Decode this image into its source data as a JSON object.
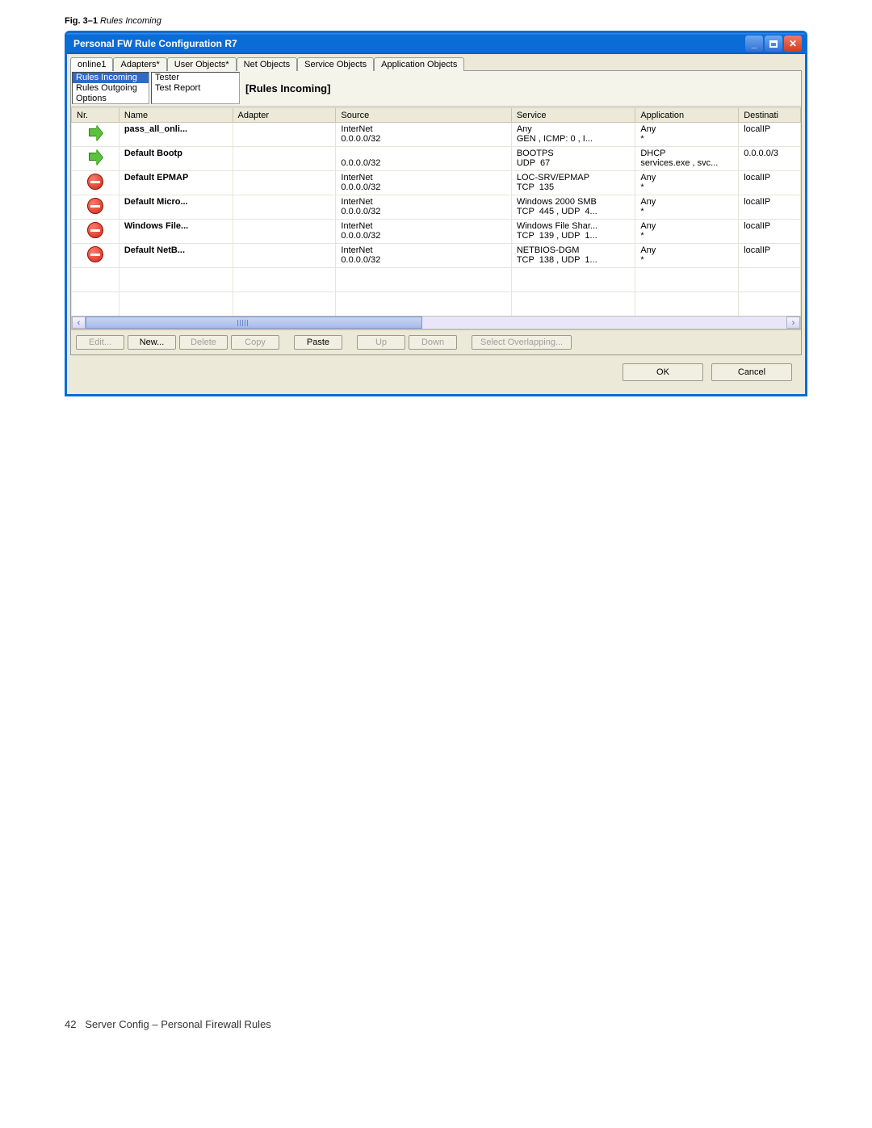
{
  "caption": {
    "label": "Fig. 3–1",
    "title": "Rules Incoming"
  },
  "window_title": "Personal FW Rule Configuration R7",
  "tabs": [
    {
      "label": "online1"
    },
    {
      "label": "Adapters*"
    },
    {
      "label": "User Objects*"
    },
    {
      "label": "Net Objects"
    },
    {
      "label": "Service Objects"
    },
    {
      "label": "Application Objects"
    }
  ],
  "left_list": {
    "items": [
      "Rules Incoming",
      "Rules Outgoing",
      "Options"
    ],
    "selected": 0
  },
  "tester_list": {
    "items": [
      "Tester",
      "Test Report"
    ]
  },
  "section_title": "[Rules Incoming]",
  "columns": [
    "Nr.",
    "Name",
    "Adapter",
    "Source",
    "Service",
    "Application",
    "Destinati"
  ],
  "col_widths": [
    "46px",
    "110px",
    "100px",
    "170px",
    "120px",
    "100px",
    "60px"
  ],
  "rows": [
    {
      "action": "allow",
      "name": "pass_all_onli...",
      "adapter": "",
      "source": [
        "InterNet",
        "0.0.0.0/32"
      ],
      "service": [
        "Any",
        "GEN , ICMP: 0 , I..."
      ],
      "app": [
        "Any",
        "*"
      ],
      "dest": "localIP"
    },
    {
      "action": "allow",
      "name": "Default Bootp",
      "adapter": "",
      "source": [
        "",
        "0.0.0.0/32"
      ],
      "service": [
        "BOOTPS",
        "UDP  67"
      ],
      "app": [
        "DHCP",
        "services.exe , svc..."
      ],
      "dest": "0.0.0.0/3"
    },
    {
      "action": "block",
      "name": "Default EPMAP",
      "adapter": "",
      "source": [
        "InterNet",
        "0.0.0.0/32"
      ],
      "service": [
        "LOC-SRV/EPMAP",
        "TCP  135"
      ],
      "app": [
        "Any",
        "*"
      ],
      "dest": "localIP"
    },
    {
      "action": "block",
      "name": "Default Micro...",
      "adapter": "",
      "source": [
        "InterNet",
        "0.0.0.0/32"
      ],
      "service": [
        "Windows 2000 SMB",
        "TCP  445 , UDP  4..."
      ],
      "app": [
        "Any",
        "*"
      ],
      "dest": "localIP"
    },
    {
      "action": "block",
      "name": "Windows File...",
      "adapter": "",
      "source": [
        "InterNet",
        "0.0.0.0/32"
      ],
      "service": [
        "Windows File Shar...",
        "TCP  139 , UDP  1..."
      ],
      "app": [
        "Any",
        "*"
      ],
      "dest": "localIP"
    },
    {
      "action": "block",
      "name": "Default NetB...",
      "adapter": "",
      "source": [
        "InterNet",
        "0.0.0.0/32"
      ],
      "service": [
        "NETBIOS-DGM",
        "TCP  138 , UDP  1..."
      ],
      "app": [
        "Any",
        "*"
      ],
      "dest": "localIP"
    }
  ],
  "empty_rows": 2,
  "buttons": {
    "edit": "Edit...",
    "new": "New...",
    "delete": "Delete",
    "copy": "Copy",
    "paste": "Paste",
    "up": "Up",
    "down": "Down",
    "overlap": "Select Overlapping...",
    "ok": "OK",
    "cancel": "Cancel"
  },
  "footer": {
    "page": "42",
    "text": "Server Config – Personal Firewall Rules"
  }
}
